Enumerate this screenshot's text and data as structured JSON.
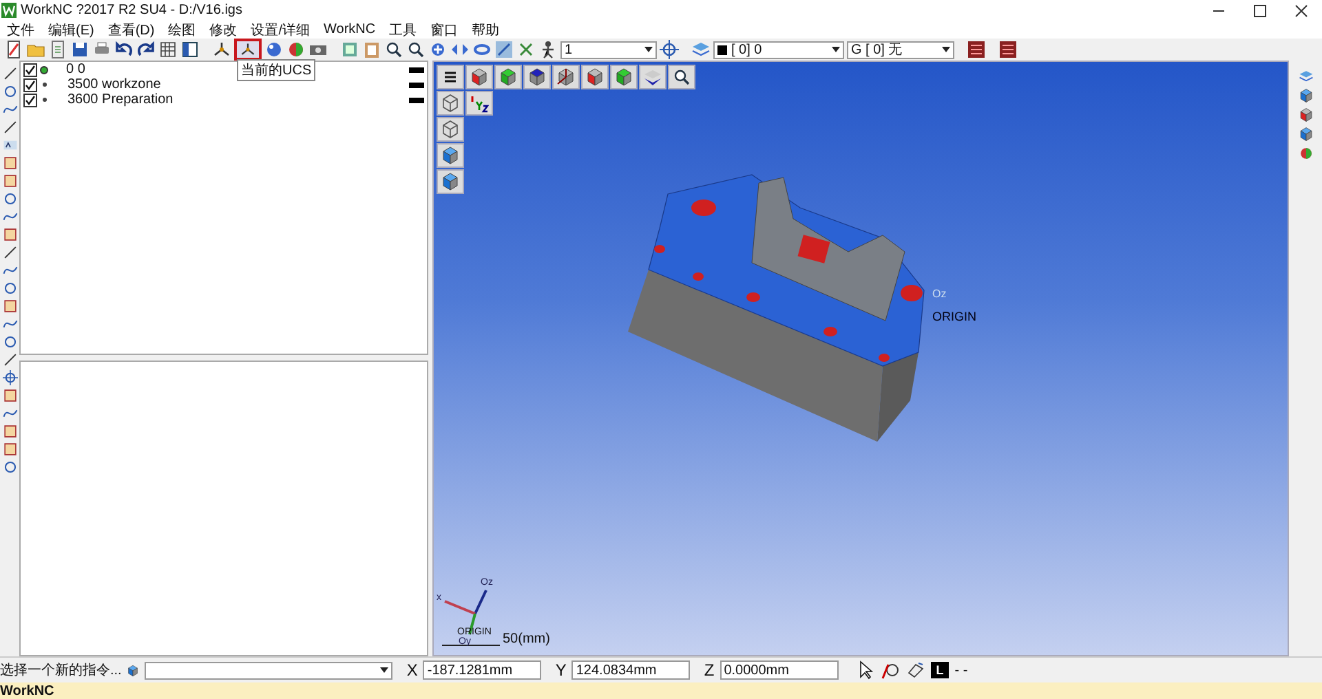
{
  "window": {
    "title": "WorkNC ?2017 R2 SU4 - D:/V16.igs"
  },
  "menu": [
    "文件",
    "编辑(E)",
    "查看(D)",
    "绘图",
    "修改",
    "设置/详细",
    "WorkNC",
    "工具",
    "窗口",
    "帮助"
  ],
  "toolbar": {
    "tooltip": "当前的UCS",
    "layer_combo": "1",
    "level_combo": "[  0] 0",
    "group_combo": "G [  0] 无"
  },
  "layers": [
    {
      "label": "0 0",
      "checked": true,
      "current": true
    },
    {
      "label": "3500 workzone",
      "checked": true,
      "current": false
    },
    {
      "label": "3600 Preparation",
      "checked": true,
      "current": false
    }
  ],
  "viewport": {
    "part_axis": "Oz",
    "part_origin": "ORIGIN",
    "triad_z": "Oz",
    "triad_x": "x",
    "triad_origin": "ORIGIN",
    "triad_y": "Oy",
    "scale": "50(mm)"
  },
  "status": {
    "prompt": "选择一个新的指令...",
    "fields": [
      {
        "label": "X",
        "value": "-187.1281mm"
      },
      {
        "label": "Y",
        "value": "124.0834mm"
      },
      {
        "label": "Z",
        "value": "0.0000mm"
      }
    ],
    "mode": "L",
    "extra": "- -"
  },
  "footer": "WorkNC"
}
